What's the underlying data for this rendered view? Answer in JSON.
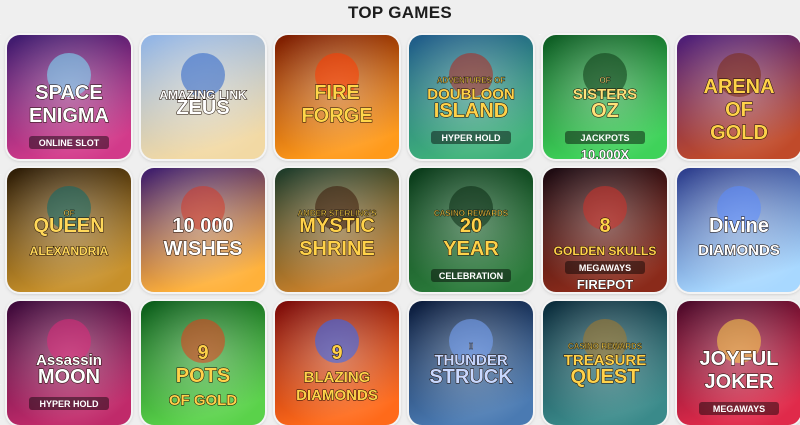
{
  "page": {
    "title": "TOP GAMES"
  },
  "games": [
    {
      "name": "space-enigma",
      "lines": [
        "SPACE",
        "ENIGMA"
      ],
      "sub": "ONLINE SLOT",
      "bg": [
        "#3a1a6e",
        "#d23a8a"
      ],
      "ink": "#ffffff",
      "accent": "#7de6ff"
    },
    {
      "name": "amazing-link-zeus",
      "lines": [
        "AMAZING LINK",
        "ZEUS"
      ],
      "sub": "",
      "bg": [
        "#8fb4e8",
        "#f2d9a4"
      ],
      "ink": "#ffffff",
      "accent": "#2a63c8"
    },
    {
      "name": "fire-forge",
      "lines": [
        "FIRE",
        "FORGE"
      ],
      "sub": "",
      "bg": [
        "#7a1a00",
        "#ff9a1a"
      ],
      "ink": "#ffd64a",
      "accent": "#ff3b00"
    },
    {
      "name": "doubloon-island",
      "lines": [
        "DOUBLOON",
        "ISLAND"
      ],
      "sub": "HYPER HOLD",
      "pre": "ADVENTURES OF",
      "bg": [
        "#1f5a8a",
        "#3fb27a"
      ],
      "ink": "#ffd24a",
      "accent": "#b3261e"
    },
    {
      "name": "sisters-of-oz-jackpots",
      "lines": [
        "SISTERS",
        "OZ"
      ],
      "sub": "JACKPOTS",
      "extra": "10,000X",
      "pre": "OF",
      "bg": [
        "#0d5a23",
        "#3fd25a"
      ],
      "ink": "#ffe27a",
      "accent": "#0c3a16"
    },
    {
      "name": "arena-of-gold",
      "lines": [
        "ARENA",
        "OF",
        "GOLD"
      ],
      "sub": "",
      "bg": [
        "#4a1d7a",
        "#c04a2a"
      ],
      "ink": "#ffd24a",
      "accent": "#7a2a14"
    },
    {
      "name": "queen-of-alexandria",
      "lines": [
        "QUEEN",
        "ALEXANDRIA"
      ],
      "pre": "OF",
      "sub": "",
      "bg": [
        "#2a1a06",
        "#c7902a"
      ],
      "ink": "#ffd85a",
      "accent": "#0d6a6a"
    },
    {
      "name": "10000-wishes",
      "lines": [
        "10 000",
        "WISHES"
      ],
      "sub": "",
      "bg": [
        "#3a1a6e",
        "#ffb13a"
      ],
      "ink": "#ffffff",
      "accent": "#d43a2a"
    },
    {
      "name": "mystic-shrine",
      "lines": [
        "MYSTIC",
        "SHRINE"
      ],
      "pre": "AMBER STERLING'S",
      "sub": "",
      "bg": [
        "#1a3a2a",
        "#c8802a"
      ],
      "ink": "#ffd24a",
      "accent": "#3a1a0a"
    },
    {
      "name": "casino-rewards-20-year-celebration",
      "lines": [
        "20",
        "YEAR"
      ],
      "pre": "CASINO REWARDS",
      "sub": "CELEBRATION",
      "bg": [
        "#0a3a1a",
        "#2a7a3a"
      ],
      "ink": "#ffd24a",
      "accent": "#0a2a12"
    },
    {
      "name": "8-golden-skulls-megaways",
      "lines": [
        "8",
        "GOLDEN SKULLS"
      ],
      "pre": "",
      "sub": "MEGAWAYS",
      "extra": "FIREPOT",
      "bg": [
        "#1a0a12",
        "#8a2a1a"
      ],
      "ink": "#ffd24a",
      "accent": "#d2322a"
    },
    {
      "name": "divine-diamonds",
      "lines": [
        "Divine",
        "DIAMONDS"
      ],
      "sub": "",
      "bg": [
        "#2a3a8a",
        "#a8d8ff"
      ],
      "ink": "#ffffff",
      "accent": "#5a8aff"
    },
    {
      "name": "assassin-moon",
      "lines": [
        "Assassin",
        "MOON"
      ],
      "sub": "HYPER HOLD",
      "bg": [
        "#3a0a3a",
        "#c02a6a"
      ],
      "ink": "#ffffff",
      "accent": "#e02a7a"
    },
    {
      "name": "9-pots-of-gold",
      "lines": [
        "9",
        "POTS",
        "OF GOLD"
      ],
      "sub": "",
      "bg": [
        "#0a5a1a",
        "#5ad24a"
      ],
      "ink": "#ffd24a",
      "accent": "#e63a1a"
    },
    {
      "name": "9-blazing-diamonds",
      "lines": [
        "9",
        "BLAZING",
        "DIAMONDS"
      ],
      "sub": "",
      "bg": [
        "#7a0a0a",
        "#ff6a1a"
      ],
      "ink": "#ffd24a",
      "accent": "#2a6aff"
    },
    {
      "name": "thunderstruck-2",
      "lines": [
        "THUNDER",
        "STRUCK"
      ],
      "pre": "II",
      "sub": "",
      "bg": [
        "#0a1a3a",
        "#4a7ab2"
      ],
      "ink": "#c8d8ff",
      "accent": "#7aa8ff"
    },
    {
      "name": "treasure-quest",
      "lines": [
        "TREASURE",
        "QUEST"
      ],
      "pre": "CASINO REWARDS",
      "sub": "",
      "bg": [
        "#0a2a3a",
        "#3a8a8a"
      ],
      "ink": "#ffd24a",
      "accent": "#a87a2a"
    },
    {
      "name": "joyful-joker-megaways",
      "lines": [
        "JOYFUL",
        "JOKER"
      ],
      "sub": "MEGAWAYS",
      "bg": [
        "#4a0a2a",
        "#e02a4a"
      ],
      "ink": "#ffffff",
      "accent": "#ffd24a"
    }
  ]
}
